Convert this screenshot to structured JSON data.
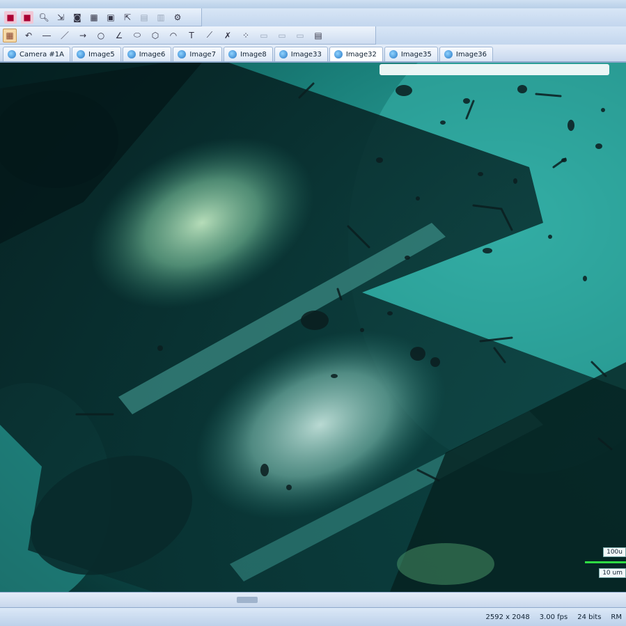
{
  "tabs": [
    {
      "label": "Camera #1A",
      "active": false
    },
    {
      "label": "Image5",
      "active": false
    },
    {
      "label": "Image6",
      "active": false
    },
    {
      "label": "Image7",
      "active": false
    },
    {
      "label": "Image8",
      "active": false
    },
    {
      "label": "Image33",
      "active": false
    },
    {
      "label": "Image32",
      "active": true
    },
    {
      "label": "Image35",
      "active": false
    },
    {
      "label": "Image36",
      "active": false
    }
  ],
  "scale": {
    "top_label": "100u",
    "bottom_label": "10 um",
    "bar_color": "#2edb44"
  },
  "status": {
    "dimensions": "2592 x 2048",
    "fps": "3.00 fps",
    "frames": "24 bits",
    "extra": "RM"
  },
  "colors": {
    "water": "#1a807a",
    "chrome": "#c8d8ee",
    "tab_icon": "#2576c4"
  }
}
